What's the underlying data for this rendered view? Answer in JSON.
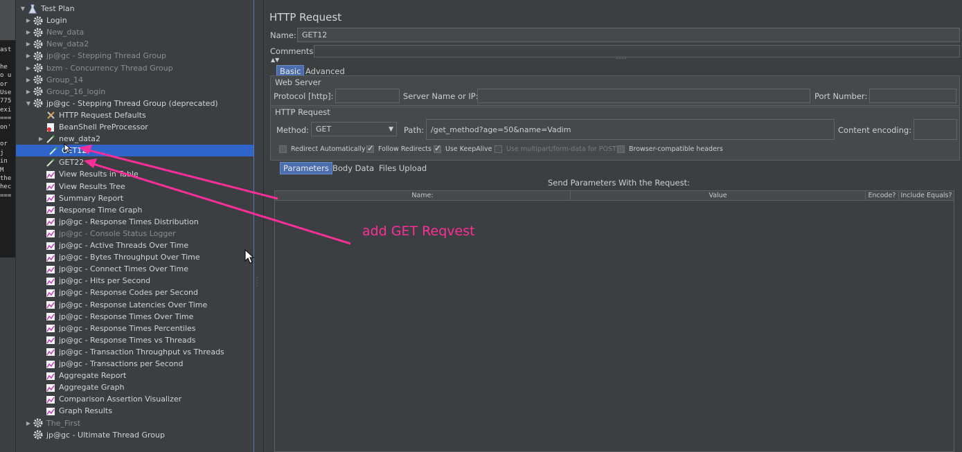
{
  "terminal": {
    "lines": [
      "ast",
      "",
      "he",
      "o u",
      "or",
      "Use",
      "775",
      "exi",
      "===",
      "on'",
      "",
      "or",
      " j",
      " in",
      "  M",
      "the",
      "hec",
      "==="
    ]
  },
  "tree": {
    "items": [
      {
        "label": "Test Plan",
        "icon": "test-plan-icon",
        "toggle": "▼",
        "indent": 0,
        "disabled": false
      },
      {
        "label": "Login",
        "icon": "gear-icon",
        "toggle": "▶",
        "indent": 1,
        "disabled": false
      },
      {
        "label": "New_data",
        "icon": "gear-icon",
        "toggle": "▶",
        "indent": 1,
        "disabled": true
      },
      {
        "label": "New_data2",
        "icon": "gear-icon",
        "toggle": "▶",
        "indent": 1,
        "disabled": true
      },
      {
        "label": "jp@gc - Stepping Thread Group",
        "icon": "gear-icon",
        "toggle": "▶",
        "indent": 1,
        "disabled": true
      },
      {
        "label": "bzm - Concurrency Thread Group",
        "icon": "gear-icon",
        "toggle": "▶",
        "indent": 1,
        "disabled": true
      },
      {
        "label": "Group_14",
        "icon": "gear-icon",
        "toggle": "▶",
        "indent": 1,
        "disabled": true
      },
      {
        "label": "Group_16_login",
        "icon": "gear-icon",
        "toggle": "▶",
        "indent": 1,
        "disabled": true
      },
      {
        "label": "jp@gc - Stepping Thread Group (deprecated)",
        "icon": "gear-icon",
        "toggle": "▼",
        "indent": 1,
        "disabled": false
      },
      {
        "label": "HTTP Request Defaults",
        "icon": "wrench-icon",
        "toggle": "",
        "indent": 2,
        "disabled": false
      },
      {
        "label": "BeanShell PreProcessor",
        "icon": "script-icon",
        "toggle": "",
        "indent": 2,
        "disabled": false
      },
      {
        "label": "new_data2",
        "icon": "pipette-icon",
        "toggle": "▶",
        "indent": 2,
        "disabled": false
      },
      {
        "label": "GET12",
        "icon": "pipette-icon",
        "toggle": "",
        "indent": 2,
        "disabled": false,
        "selected": true
      },
      {
        "label": "GET22",
        "icon": "pipette-icon",
        "toggle": "",
        "indent": 2,
        "disabled": false
      },
      {
        "label": "View Results in Table",
        "icon": "chart-icon",
        "toggle": "",
        "indent": 2,
        "disabled": false
      },
      {
        "label": "View Results Tree",
        "icon": "chart-icon",
        "toggle": "",
        "indent": 2,
        "disabled": false
      },
      {
        "label": "Summary Report",
        "icon": "chart-icon",
        "toggle": "",
        "indent": 2,
        "disabled": false
      },
      {
        "label": "Response Time Graph",
        "icon": "chart-icon",
        "toggle": "",
        "indent": 2,
        "disabled": false
      },
      {
        "label": "jp@gc - Response Times Distribution",
        "icon": "chart-icon",
        "toggle": "",
        "indent": 2,
        "disabled": false
      },
      {
        "label": "jp@gc - Console Status Logger",
        "icon": "chart-icon",
        "toggle": "",
        "indent": 2,
        "disabled": true
      },
      {
        "label": "jp@gc - Active Threads Over Time",
        "icon": "chart-icon",
        "toggle": "",
        "indent": 2,
        "disabled": false
      },
      {
        "label": "jp@gc - Bytes Throughput Over Time",
        "icon": "chart-icon",
        "toggle": "",
        "indent": 2,
        "disabled": false
      },
      {
        "label": "jp@gc - Connect Times Over Time",
        "icon": "chart-icon",
        "toggle": "",
        "indent": 2,
        "disabled": false
      },
      {
        "label": "jp@gc - Hits per Second",
        "icon": "chart-icon",
        "toggle": "",
        "indent": 2,
        "disabled": false
      },
      {
        "label": "jp@gc - Response Codes per Second",
        "icon": "chart-icon",
        "toggle": "",
        "indent": 2,
        "disabled": false
      },
      {
        "label": "jp@gc - Response Latencies Over Time",
        "icon": "chart-icon",
        "toggle": "",
        "indent": 2,
        "disabled": false
      },
      {
        "label": "jp@gc - Response Times Over Time",
        "icon": "chart-icon",
        "toggle": "",
        "indent": 2,
        "disabled": false
      },
      {
        "label": "jp@gc - Response Times Percentiles",
        "icon": "chart-icon",
        "toggle": "",
        "indent": 2,
        "disabled": false
      },
      {
        "label": "jp@gc - Response Times vs Threads",
        "icon": "chart-icon",
        "toggle": "",
        "indent": 2,
        "disabled": false
      },
      {
        "label": "jp@gc - Transaction Throughput vs Threads",
        "icon": "chart-icon",
        "toggle": "",
        "indent": 2,
        "disabled": false
      },
      {
        "label": "jp@gc - Transactions per Second",
        "icon": "chart-icon",
        "toggle": "",
        "indent": 2,
        "disabled": false
      },
      {
        "label": "Aggregate Report",
        "icon": "chart-icon",
        "toggle": "",
        "indent": 2,
        "disabled": false
      },
      {
        "label": "Aggregate Graph",
        "icon": "chart-icon",
        "toggle": "",
        "indent": 2,
        "disabled": false
      },
      {
        "label": "Comparison Assertion Visualizer",
        "icon": "chart-icon",
        "toggle": "",
        "indent": 2,
        "disabled": false
      },
      {
        "label": "Graph Results",
        "icon": "chart-icon",
        "toggle": "",
        "indent": 2,
        "disabled": false
      },
      {
        "label": "The_First",
        "icon": "gear-icon",
        "toggle": "▶",
        "indent": 1,
        "disabled": true
      },
      {
        "label": "jp@gc - Ultimate Thread Group",
        "icon": "gear-icon",
        "toggle": "",
        "indent": 1,
        "disabled": false
      }
    ]
  },
  "editor": {
    "title": "HTTP Request",
    "name_label": "Name:",
    "name_value": "GET12",
    "comments_label": "Comments:",
    "tabs": [
      "Basic",
      "Advanced"
    ],
    "web_server": {
      "section_label": "Web Server",
      "protocol_label": "Protocol [http]:",
      "protocol_value": "",
      "server_label": "Server Name or IP:",
      "server_value": "",
      "port_label": "Port Number:",
      "port_value": ""
    },
    "http_request": {
      "section_label": "HTTP Request",
      "method_label": "Method:",
      "method_value": "GET",
      "path_label": "Path:",
      "path_value": "/get_method?age=50&name=Vadim",
      "encoding_label": "Content encoding:",
      "encoding_value": ""
    },
    "checkboxes": [
      {
        "label": "Redirect Automatically",
        "checked": false,
        "enabled": true
      },
      {
        "label": "Follow Redirects",
        "checked": true,
        "enabled": true
      },
      {
        "label": "Use KeepAlive",
        "checked": true,
        "enabled": true
      },
      {
        "label": "Use multipart/form-data for POST",
        "checked": false,
        "enabled": false
      },
      {
        "label": "Browser-compatible headers",
        "checked": false,
        "enabled": true
      }
    ],
    "param_tabs": [
      "Parameters",
      "Body Data",
      "Files Upload"
    ],
    "params_caption": "Send Parameters With the Request:",
    "params_columns": [
      "Name:",
      "Value",
      "Encode?",
      "Include Equals?"
    ]
  },
  "annotation": {
    "text": "add GET Reqvest",
    "color": "#ff2e9a"
  },
  "colors": {
    "background": "#3c3f41",
    "selection": "#2f65ca",
    "tab_active": "#4b6eaf"
  }
}
